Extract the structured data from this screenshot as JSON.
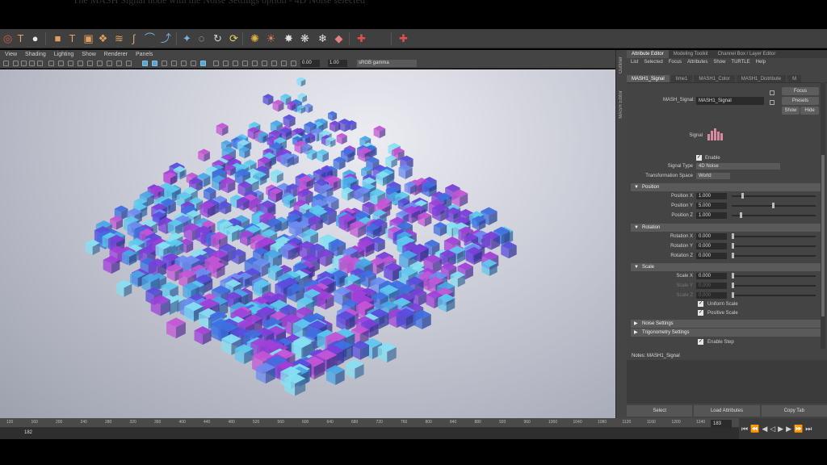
{
  "overlay_text": "The MASH Signal node with the Noise Settings option - 4D Noise selected",
  "shelf": {
    "icons": [
      "torus-icon",
      "text-icon",
      "sphere-icon",
      "cube-icon",
      "text-tool-icon",
      "box-icon",
      "duplicate-icon",
      "stack-icon",
      "pipe-icon",
      "curve-icon",
      "path-icon",
      "tool-icon",
      "ring-icon",
      "loop-icon",
      "rotate-icon",
      "light-icon",
      "sun-icon",
      "star-icon",
      "spark-icon",
      "flake-icon",
      "gem-icon",
      "bag-icon",
      "plus-icon"
    ]
  },
  "viewport": {
    "menu": [
      "View",
      "Shading",
      "Lighting",
      "Show",
      "Renderer",
      "Panels"
    ],
    "field1": "0.00",
    "field2": "1.00",
    "color_space": "sRGB gamma"
  },
  "side_tabs": [
    "Outliner",
    "MASH Editor"
  ],
  "panel": {
    "tabs": [
      "Attribute Editor",
      "Modeling Toolkit",
      "Channel Box / Layer Editor"
    ],
    "menu": [
      "List",
      "Selected",
      "Focus",
      "Attributes",
      "Show",
      "TURTLE",
      "Help"
    ],
    "node_tabs": [
      "MASH1_Signal",
      "time1",
      "MASH1_Color",
      "MASH1_Distribute",
      "M"
    ],
    "node_label": "MASH_Signal:",
    "node_value": "MASH1_Signal",
    "focus": "Focus",
    "presets": "Presets",
    "show": "Show",
    "hide": "Hide",
    "signal_label": "Signal",
    "enable": "Enable",
    "signal_type_label": "Signal Type",
    "signal_type": "4D Noise",
    "transform_space_label": "Transformation Space",
    "transform_space": "World",
    "sections": {
      "position": "Position",
      "rotation": "Rotation",
      "scale": "Scale",
      "noise": "Noise Settings",
      "trig": "Trigonometry Settings"
    },
    "position": [
      {
        "label": "Position X",
        "value": "1.000",
        "level": 0.12
      },
      {
        "label": "Position Y",
        "value": "5.000",
        "level": 0.48
      },
      {
        "label": "Position Z",
        "value": "1.000",
        "level": 0.1
      }
    ],
    "rotation": [
      {
        "label": "Rotation X",
        "value": "0.000"
      },
      {
        "label": "Rotation Y",
        "value": "0.000"
      },
      {
        "label": "Rotation Z",
        "value": "0.000"
      }
    ],
    "scale": [
      {
        "label": "Scale X",
        "value": "0.000"
      },
      {
        "label": "Scale Y",
        "value": "0.000"
      },
      {
        "label": "Scale Z",
        "value": "0.000"
      }
    ],
    "uniform_scale": "Uniform Scale",
    "positive_scale": "Positive Scale",
    "enable_step": "Enable Step",
    "notes": "Notes:  MASH1_Signal",
    "buttons": [
      "Select",
      "Load Attributes",
      "Copy Tab"
    ]
  },
  "timeline": {
    "ticks": [
      "120",
      "160",
      "200",
      "240",
      "280",
      "320",
      "360",
      "400",
      "440",
      "480",
      "520",
      "560",
      "600",
      "640",
      "680",
      "720",
      "760",
      "800",
      "840",
      "880",
      "920",
      "960",
      "1000",
      "1040",
      "1080",
      "1120",
      "1160",
      "1200",
      "1240",
      "1280"
    ],
    "start_frame": "182",
    "current_frame": "183"
  },
  "colors": {
    "cube_palette": [
      "#5ec8ee",
      "#4aa6e6",
      "#3f6fe0",
      "#5a4ddc",
      "#7a3fd8",
      "#a040d8",
      "#c455d6",
      "#6b8cf0",
      "#86e0f2"
    ]
  }
}
